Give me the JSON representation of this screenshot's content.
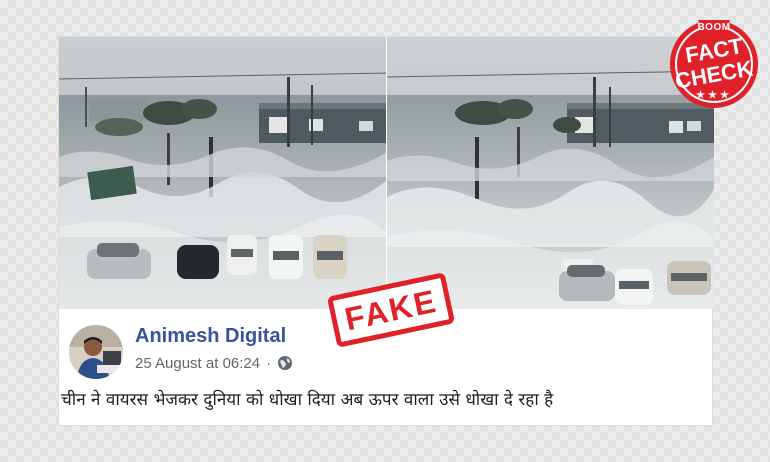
{
  "post": {
    "author_name": "Animesh Digital",
    "timestamp": "25 August at 06:24",
    "separator": "·",
    "audience_icon": "globe-icon",
    "text": "चीन ने वायरस भेजकर दुनिया को धोखा दिया अब ऊपर वाला उसे धोखा दे रहा है",
    "link_color": "#36539b"
  },
  "stamp": {
    "label": "FAKE",
    "color": "#e0212a"
  },
  "badge": {
    "top_label": "BOOM",
    "line1": "FACT",
    "line2": "CHECK",
    "stars": "★★★",
    "color": "#e0212a"
  }
}
